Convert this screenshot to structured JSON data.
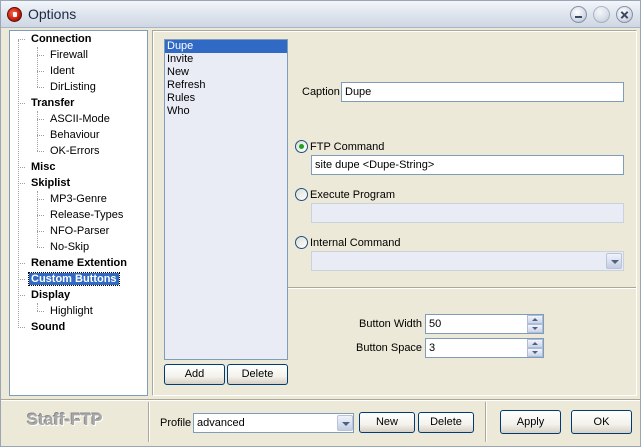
{
  "window": {
    "title": "Options"
  },
  "tree": {
    "connection": {
      "label": "Connection",
      "children": [
        "Firewall",
        "Ident",
        "DirListing"
      ]
    },
    "transfer": {
      "label": "Transfer",
      "children": [
        "ASCII-Mode",
        "Behaviour",
        "OK-Errors"
      ]
    },
    "misc": {
      "label": "Misc"
    },
    "skiplist": {
      "label": "Skiplist",
      "children": [
        "MP3-Genre",
        "Release-Types",
        "NFO-Parser",
        "No-Skip"
      ]
    },
    "rename": {
      "label": "Rename Extention"
    },
    "custom": {
      "label": "Custom Buttons",
      "selected": true
    },
    "display": {
      "label": "Display",
      "children": [
        "Highlight"
      ]
    },
    "sound": {
      "label": "Sound"
    }
  },
  "buttons_list": {
    "items": [
      "Dupe",
      "Invite",
      "New",
      "Refresh",
      "Rules",
      "Who"
    ],
    "selected_index": 0
  },
  "list_actions": {
    "add": "Add",
    "delete": "Delete"
  },
  "form": {
    "caption_label": "Caption",
    "caption_value": "Dupe",
    "ftp_label": "FTP Command",
    "ftp_value": "site dupe <Dupe-String>",
    "exec_label": "Execute Program",
    "exec_value": "",
    "internal_label": "Internal Command",
    "internal_value": "",
    "selected_mode": "ftp",
    "width_label": "Button Width",
    "width_value": "50",
    "space_label": "Button Space",
    "space_value": "3"
  },
  "footer": {
    "brand": "Staff-FTP",
    "profile_label": "Profile",
    "profile_value": "advanced",
    "new": "New",
    "delete": "Delete",
    "apply": "Apply",
    "ok": "OK"
  },
  "colors": {
    "selection": "#316ac5",
    "radio_dot": "#21a121",
    "border": "#7f9db9"
  }
}
